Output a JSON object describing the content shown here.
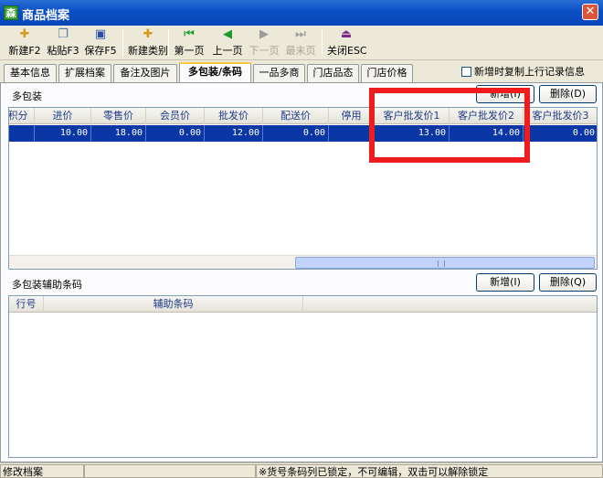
{
  "window": {
    "title": "商品档案",
    "app_icon": "森",
    "close_symbol": "✕"
  },
  "toolbar": [
    {
      "label": "新建F2",
      "icon": "new-icon",
      "glyph": "✚",
      "color": "#d89a1e",
      "enabled": true
    },
    {
      "label": "粘贴F3",
      "icon": "paste-icon",
      "glyph": "❐",
      "color": "#5577aa",
      "enabled": true
    },
    {
      "label": "保存F5",
      "icon": "save-icon",
      "glyph": "▣",
      "color": "#2a4fa8",
      "enabled": true
    },
    {
      "label": "新建类别",
      "icon": "new-category-icon",
      "glyph": "✚",
      "color": "#d89a1e",
      "enabled": true
    },
    {
      "label": "第一页",
      "icon": "first-page-icon",
      "glyph": "⏮",
      "color": "#1a9a2a",
      "enabled": true
    },
    {
      "label": "上一页",
      "icon": "prev-page-icon",
      "glyph": "◀",
      "color": "#1a9a2a",
      "enabled": true
    },
    {
      "label": "下一页",
      "icon": "next-page-icon",
      "glyph": "▶",
      "color": "#9a9a9a",
      "enabled": false
    },
    {
      "label": "最末页",
      "icon": "last-page-icon",
      "glyph": "⏭",
      "color": "#9a9a9a",
      "enabled": false
    },
    {
      "label": "关闭ESC",
      "icon": "close-door-icon",
      "glyph": "⏏",
      "color": "#7a2a8a",
      "enabled": true
    }
  ],
  "tabs": [
    {
      "label": "基本信息",
      "active": false
    },
    {
      "label": "扩展档案",
      "active": false
    },
    {
      "label": "备注及图片",
      "active": false
    },
    {
      "label": "多包装/条码",
      "active": true
    },
    {
      "label": "一品多商",
      "active": false
    },
    {
      "label": "门店品态",
      "active": false
    },
    {
      "label": "门店价格",
      "active": false
    }
  ],
  "copy_checkbox": {
    "label": "新增时复制上行记录信息",
    "checked": false
  },
  "package_section": {
    "title": "多包装",
    "add_label": "新增(I)",
    "delete_label": "删除(D)",
    "columns": [
      "积分",
      "进价",
      "零售价",
      "会员价",
      "批发价",
      "配送价",
      "停用",
      "客户批发价1",
      "客户批发价2",
      "客户批发价3"
    ],
    "rows": [
      [
        "",
        "10.00",
        "18.00",
        "0.00",
        "12.00",
        "0.00",
        "",
        "13.00",
        "14.00",
        "0.00"
      ]
    ]
  },
  "barcode_section": {
    "title": "多包装辅助条码",
    "add_label": "新增(I)",
    "delete_label": "删除(Q)",
    "columns": [
      "行号",
      "辅助条码"
    ]
  },
  "status": {
    "left": "修改档案",
    "middle": "",
    "message": "※货号条码列已锁定，不可编辑，双击可以解除锁定"
  }
}
